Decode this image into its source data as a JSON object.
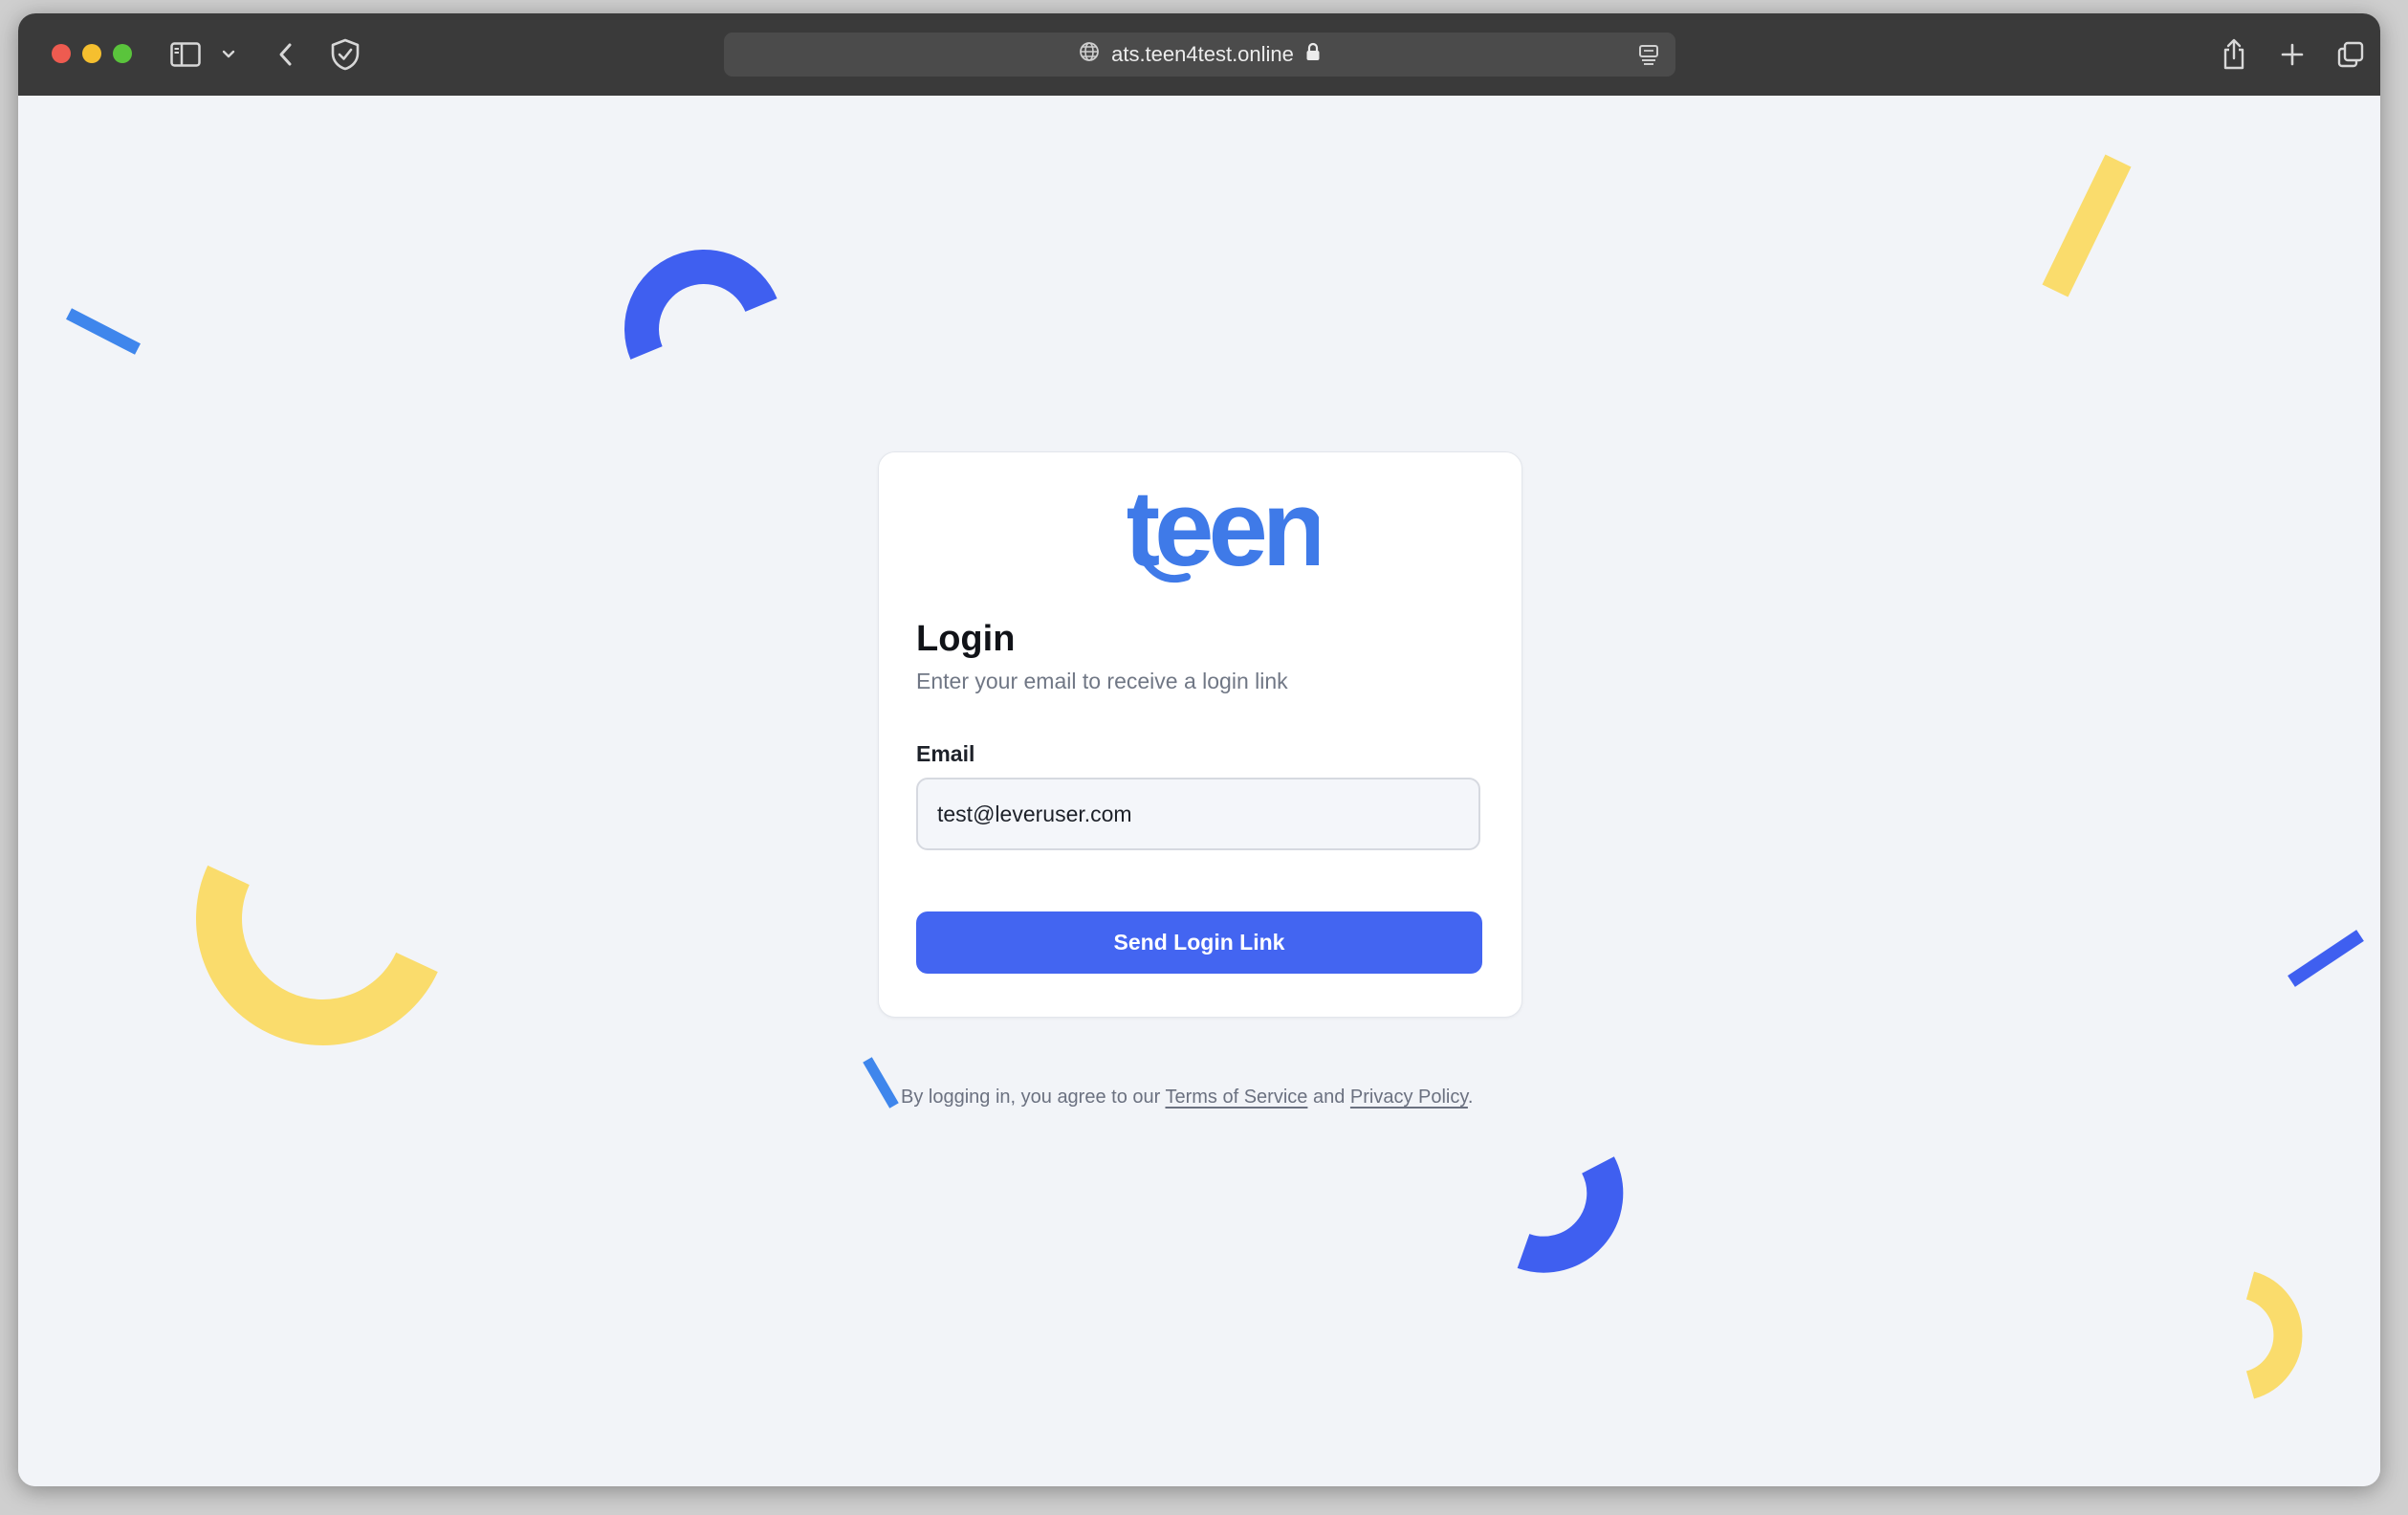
{
  "browser": {
    "url": "ats.teen4test.online"
  },
  "icons": {
    "sidebar": "sidebar-icon",
    "chevron_down": "chevron-down-icon",
    "back": "chevron-left-icon",
    "shield": "shield-icon",
    "globe": "globe-icon",
    "lock": "lock-icon",
    "reader": "reader-icon",
    "share": "share-icon",
    "new_tab": "plus-icon",
    "tab_overview": "tabs-icon"
  },
  "login": {
    "logo_text": "teen",
    "title": "Login",
    "subtitle": "Enter your email to receive a login link",
    "email_label": "Email",
    "email_value": "test@leveruser.com",
    "submit_label": "Send Login Link"
  },
  "footer": {
    "prefix": "By logging in, you agree to our ",
    "terms": "Terms of Service",
    "and": " and ",
    "privacy": "Privacy Policy",
    "suffix": "."
  },
  "colors": {
    "primary": "#4365f1",
    "accent_blue": "#3f86ec",
    "accent_yellow": "#fadc6c",
    "page_bg": "#f2f4f8",
    "toolbar_bg": "#3a3a3a"
  }
}
